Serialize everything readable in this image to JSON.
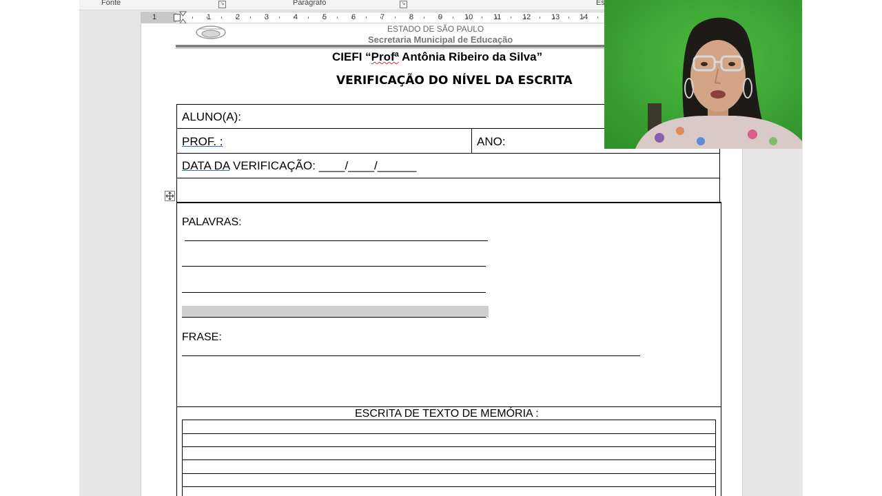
{
  "ribbon": {
    "groups": [
      "Fonte",
      "Parágrafo",
      "Es"
    ]
  },
  "ruler": {
    "numbers": [
      "1",
      "1",
      "2",
      "3",
      "4",
      "5",
      "6",
      "7",
      "8",
      "9",
      "10",
      "11",
      "12",
      "13",
      "14"
    ]
  },
  "document": {
    "header": {
      "state": "ESTADO DE SÃO PAULO",
      "secretaria": "Secretaria Municipal de Educação"
    },
    "school_prefix": "CIEFI “",
    "school_prof": "Profª",
    "school_name": " Antônia Ribeiro da Silva”",
    "title": "VERIFICAÇÃO DO NÍVEL DA ESCRITA",
    "form": {
      "aluno_label": "ALUNO(A):",
      "prof_label": "PROF. :",
      "ano_label": "ANO:",
      "data_underlined": "DATA  DA",
      "data_rest": " VERIFICAÇÃO: ____/____/______"
    },
    "palavras_label": "PALAVRAS:",
    "frase_label": "FRASE:",
    "memoria_label": "ESCRITA DE TEXTO DE MEMÓRIA :"
  },
  "colors": {
    "app_background": "#e6e6e6",
    "page": "#ffffff",
    "webcam_green": "#3aa534",
    "highlight_gray": "#cfcfcf"
  },
  "icons": [
    "table-move-handle-icon",
    "school-crest-logo",
    "first-line-indent-marker-icon"
  ]
}
